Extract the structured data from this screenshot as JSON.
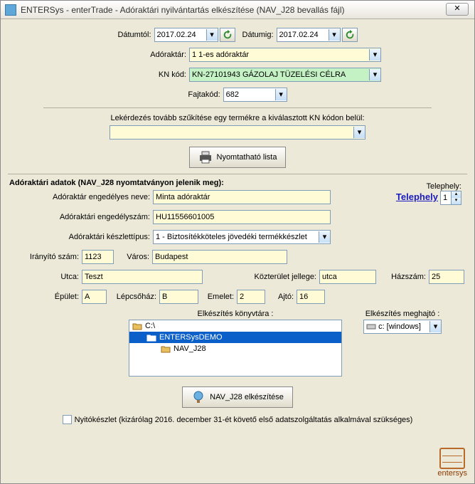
{
  "title": "ENTERSys - enterTrade - Adóraktári nyilvántartás elkészítése (NAV_J28 bevallás fájl)",
  "labels": {
    "datumtol": "Dátumtól:",
    "datumig": "Dátumig:",
    "adoraktar": "Adóraktár:",
    "knkod": "KN kód:",
    "fajtakod": "Fajtakód:",
    "szukites": "Lekérdezés tovább szűkítése egy termékre a kiválasztott KN kódon belül:",
    "nyomtat": "Nyomtatható lista",
    "telephely_lbl": "Telephely:",
    "telephely_link": "Telephely",
    "telephely_num": "1",
    "section": "Adóraktári adatok (NAV_J28 nyomtatványon jelenik meg):",
    "eng_nev": "Adóraktár engedélyes neve:",
    "eng_szam": "Adóraktári engedélyszám:",
    "keszlettipus": "Adóraktári készlettípus:",
    "irszam": "Irányító szám:",
    "varos": "Város:",
    "utca": "Utca:",
    "kozterulet": "Közterület jellege:",
    "hazszam": "Házszám:",
    "epulet": "Épület:",
    "lepcsohaz": "Lépcsőház:",
    "emelet": "Emelet:",
    "ajto": "Ajtó:",
    "konyvtar": "Elkészítés könyvtára :",
    "meghajto": "Elkészítés meghajtó :",
    "elkeszites": "NAV_J28 elkészítése",
    "nyitokeszlet": "Nyitókészlet (kizárólag 2016. december 31-ét követő első adatszolgáltatás alkalmával szükséges)",
    "logo": "entersys"
  },
  "values": {
    "datumtol": "2017.02.24",
    "datumig": "2017.02.24",
    "adoraktar": "1 1-es adóraktár",
    "knkod": "KN-27101943  GÁZOLAJ TÜZELÉSI CÉLRA",
    "fajtakod": "682",
    "szukites": "",
    "eng_nev": "Minta adóraktár",
    "eng_szam": "HU11556601005",
    "keszlettipus": "1 - Biztosítékköteles jövedéki termékkészlet",
    "irszam": "1123",
    "varos": "Budapest",
    "utca": "Teszt",
    "kozterulet": "utca",
    "hazszam": "25",
    "epulet": "A",
    "lepcsohaz": "B",
    "emelet": "2",
    "ajto": "16",
    "meghajto": "c: [windows]"
  },
  "tree": {
    "root": "C:\\",
    "sel": "ENTERSysDEMO",
    "child": "NAV_J28"
  }
}
